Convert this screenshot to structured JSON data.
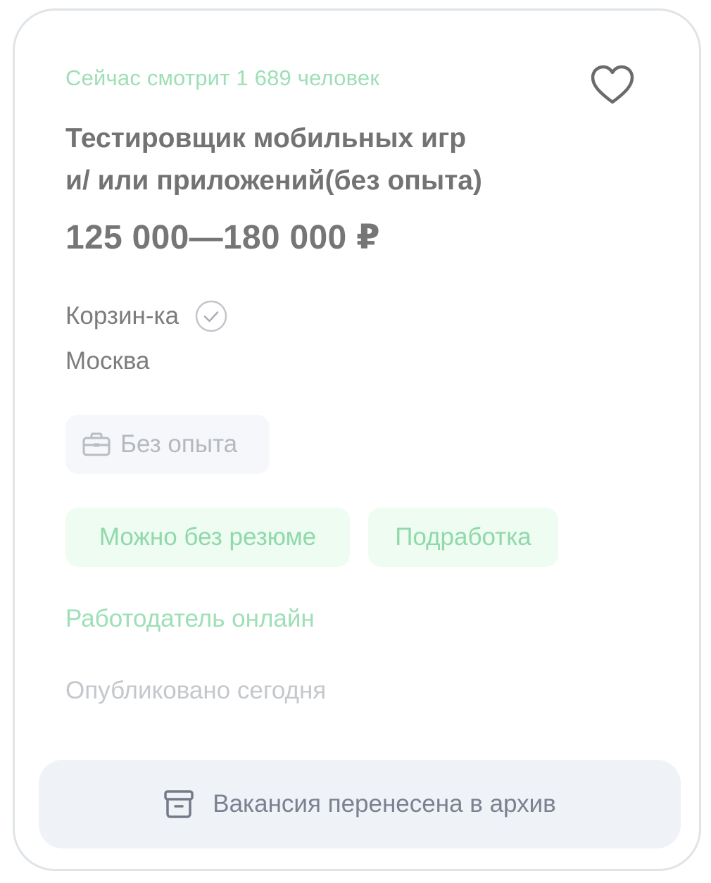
{
  "vacancy": {
    "viewers_text": "Сейчас смотрит 1 689 человек",
    "title_line1": "Тестировщик мобильных игр",
    "title_line2": "и/ или приложений(без опыта)",
    "salary": "125 000—180 000 ₽",
    "company": "Корзин-ка",
    "city": "Москва",
    "experience": "Без опыта",
    "tags": [
      "Можно без резюме",
      "Подработка"
    ],
    "employer_status": "Работодатель онлайн",
    "published": "Опубликовано сегодня",
    "archive_label": "Вакансия перенесена в архив"
  },
  "icons": {
    "favorite": "heart-icon",
    "verified": "check-circle-icon",
    "experience": "briefcase-icon",
    "archive": "archive-box-icon"
  },
  "colors": {
    "accent_green": "#9ddfb6",
    "tag_bg": "#eefcf2",
    "chip_bg": "#f5f7fa",
    "button_bg": "#eff2f7",
    "text_gray": "#737373"
  }
}
